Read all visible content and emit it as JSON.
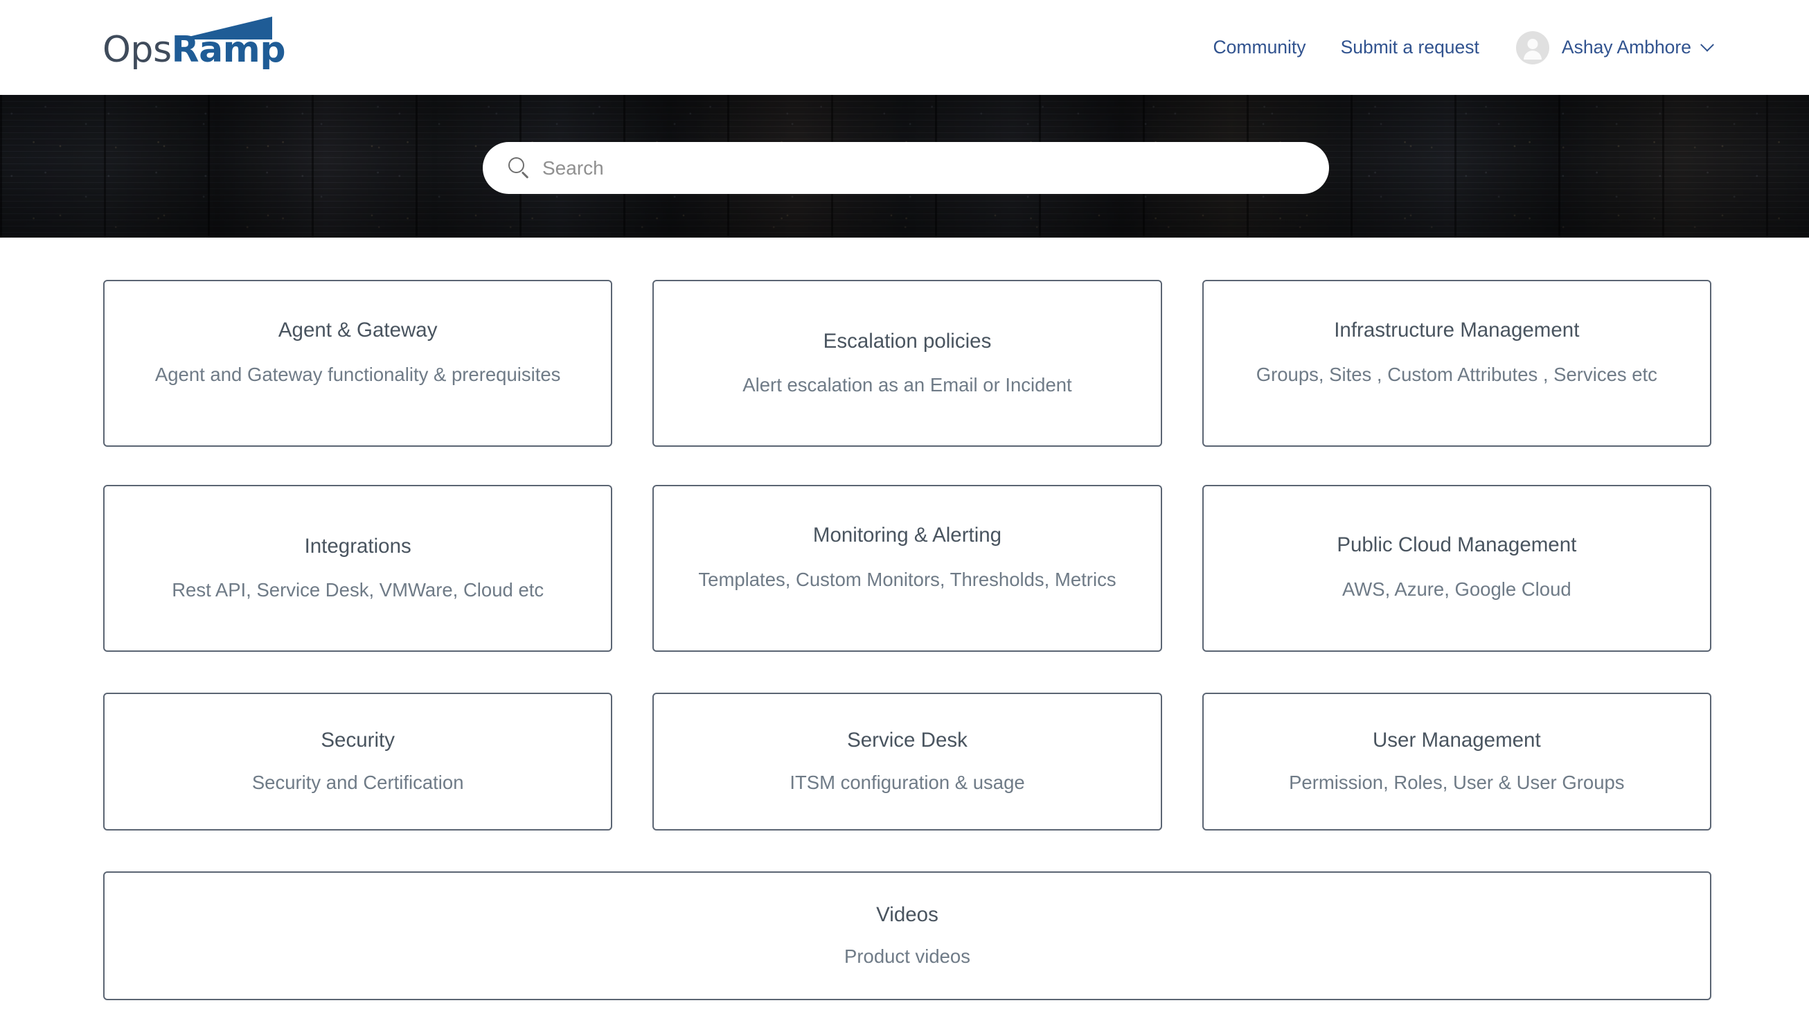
{
  "header": {
    "logo": {
      "part1": "Ops",
      "part2": "Ramp",
      "wedge_icon": "triangle-wedge-icon"
    },
    "nav": [
      {
        "label": "Community",
        "name": "nav-link-community"
      },
      {
        "label": "Submit a request",
        "name": "nav-link-submit-a-request"
      }
    ],
    "user": {
      "name": "Ashay Ambhore",
      "avatar_icon": "user-avatar-icon",
      "chevron_icon": "chevron-down-icon"
    }
  },
  "hero": {
    "background_image": "city-skyline-night-photo",
    "search": {
      "placeholder": "Search",
      "value": "",
      "icon": "search-icon"
    }
  },
  "colors": {
    "brand_blue": "#1f5c96",
    "link_blue": "#31538f",
    "card_border": "#5b6573",
    "card_title": "#49545f",
    "card_desc": "#6f7b87",
    "avatar_bg": "#e0e0e0"
  },
  "categories": {
    "rows": [
      [
        {
          "title": "Agent & Gateway",
          "desc": "Agent and Gateway functionality & prerequisites",
          "name": "category-card-agent-gateway",
          "align": "top"
        },
        {
          "title": "Escalation policies",
          "desc": "Alert escalation as an Email or Incident",
          "name": "category-card-escalation-policies",
          "align": "center"
        },
        {
          "title": "Infrastructure Management",
          "desc": "Groups, Sites , Custom Attributes , Services etc",
          "name": "category-card-infrastructure-management",
          "align": "top"
        }
      ],
      [
        {
          "title": "Integrations",
          "desc": "Rest API, Service Desk, VMWare, Cloud etc",
          "name": "category-card-integrations",
          "align": "center"
        },
        {
          "title": "Monitoring & Alerting",
          "desc": "Templates, Custom Monitors, Thresholds, Metrics",
          "name": "category-card-monitoring-alerting",
          "align": "top"
        },
        {
          "title": "Public Cloud Management",
          "desc": "AWS, Azure, Google Cloud",
          "name": "category-card-public-cloud-management",
          "align": "top"
        }
      ],
      [
        {
          "title": "Security",
          "desc": "Security and Certification",
          "name": "category-card-security",
          "align": "center"
        },
        {
          "title": "Service Desk",
          "desc": "ITSM configuration & usage",
          "name": "category-card-service-desk",
          "align": "center"
        },
        {
          "title": "User Management",
          "desc": "Permission, Roles, User & User Groups",
          "name": "category-card-user-management",
          "align": "center"
        }
      ]
    ],
    "wide": {
      "title": "Videos",
      "desc": "Product videos",
      "name": "category-card-videos"
    }
  }
}
